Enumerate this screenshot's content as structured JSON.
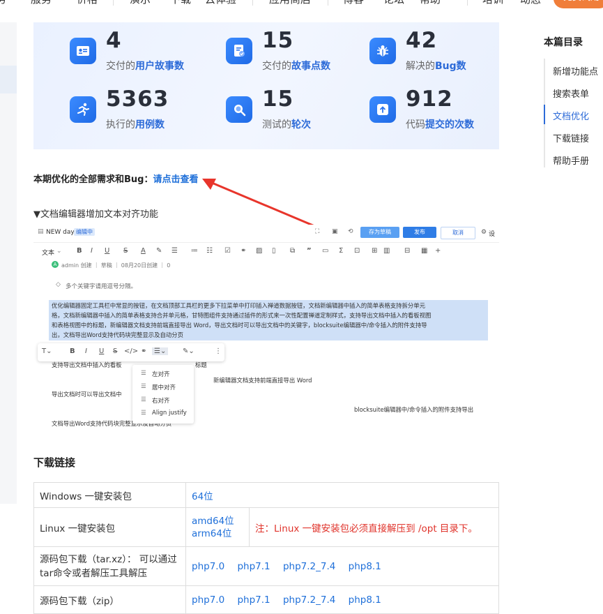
{
  "topnav": {
    "items": [
      "服务",
      "价格",
      "演示",
      "下载",
      "云体验",
      "应用商店",
      "博客",
      "论坛",
      "帮助",
      "培训",
      "动态"
    ],
    "cta": "免费试用"
  },
  "stats": [
    {
      "number": "4",
      "label_pre": "交付的",
      "label_em": "用户故事数",
      "icon": "id-card-icon"
    },
    {
      "number": "15",
      "label_pre": "交付的",
      "label_em": "故事点数",
      "icon": "document-check-icon"
    },
    {
      "number": "42",
      "label_pre": "解决的",
      "label_em": "Bug数",
      "icon": "bug-icon"
    },
    {
      "number": "5363",
      "label_pre": "执行的",
      "label_em": "用例数",
      "icon": "runner-icon"
    },
    {
      "number": "15",
      "label_pre": "测试的",
      "label_em": "轮次",
      "icon": "magnifier-icon"
    },
    {
      "number": "912",
      "label_pre": "代码",
      "label_em": "提交的次数",
      "icon": "upload-icon"
    }
  ],
  "toc": {
    "title": "本篇目录",
    "items": [
      "新增功能点",
      "搜索表单",
      "文档优化",
      "下载链接",
      "帮助手册"
    ],
    "active_index": 2
  },
  "requirements": {
    "label": "本期优化的全部需求和Bug：",
    "link": "请点击查看"
  },
  "feature_title": "▼文档编辑器增加文本对齐功能",
  "editor_shot": {
    "doc_title": "NEW day",
    "badge": "编辑中",
    "save_draft": "存为草稿",
    "publish": "发布",
    "cancel": "取消",
    "settings": "设",
    "text_style": "文本",
    "meta": "admin 创建 ｜ 草稿 ｜ 08月20日创建 ｜ 0",
    "keyword_hint": "多个关键字请用逗号分隔。",
    "para_lines": [
      "优化编辑器固定工具栏中常显的按钮，在文档顶部工具栏的更多下拉菜单中打印插入禅道数据按钮，文档新编辑器中插入的简单表格支持拆分单元",
      "格，文档新编辑器中插入的简单表格支持合并单元格，甘特图组件支持通过插件的形式来一次性配置禅道定制样式，支持导出文档中插入的看板视图",
      "和表格视图中的标题，新编辑器文档支持前端直接导出 Word，导出文档时可以导出文档中的关键字，blocksuite编辑器中/命令插入的附件支持导",
      "出，文档导出Word支持代码块完整显示及自动分页"
    ],
    "line_a": "支持导出文档中插入的看板",
    "line_a_tail": "标题",
    "line_b": "新编辑器文档支持前端直接导出 Word",
    "line_c": "导出文档时可以导出文档中",
    "line_d": "blocksuite编辑器中/命令插入的附件支持导出",
    "line_e": "文档导出Word支持代码块完整显示及自动分页",
    "align_options": [
      "左对齐",
      "居中对齐",
      "右对齐",
      "Align justify"
    ]
  },
  "downloads": {
    "title": "下载链接",
    "rows": [
      {
        "label": "Windows 一键安装包",
        "links": [
          "64位"
        ],
        "note": ""
      },
      {
        "label": "Linux 一键安装包",
        "links": [
          "amd64位",
          "arm64位"
        ],
        "note": "注：Linux 一键安装包必须直接解压到 /opt 目录下。"
      },
      {
        "label": "源码包下载（tar.xz）： 可以通过tar命令或者解压工具解压",
        "links": [
          "php7.0",
          "php7.1",
          "php7.2_7.4",
          "php8.1"
        ],
        "note": ""
      },
      {
        "label": "源码包下载（zip）",
        "links": [
          "php7.0",
          "php7.1",
          "php7.2_7.4",
          "php8.1"
        ],
        "note": ""
      }
    ]
  }
}
